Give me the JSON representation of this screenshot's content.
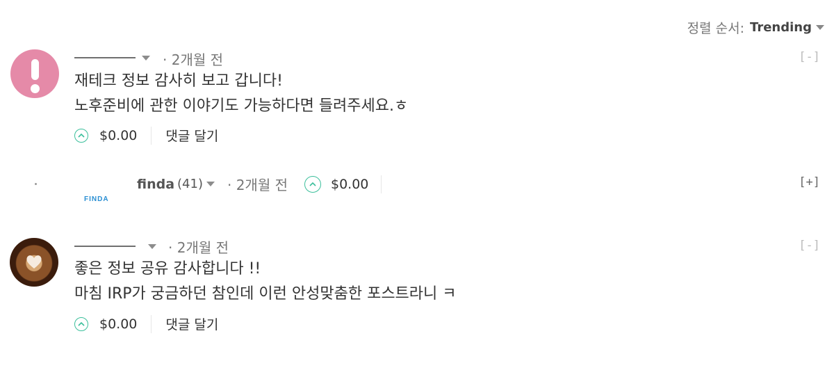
{
  "sort": {
    "label": "정렬 순서:",
    "value": "Trending"
  },
  "comments": [
    {
      "time": "2개월 전",
      "collapse": "[-]",
      "lines": [
        "재테크 정보 감사히 보고 갑니다!",
        "노후준비에 관한 이야기도 가능하다면 들려주세요.ㅎ"
      ],
      "payout": "$0.00",
      "reply": "댓글 달기",
      "avatar_color": "#e58aa8"
    },
    {
      "author": "finda",
      "reputation": "(41)",
      "time": "2개월 전",
      "payout": "$0.00",
      "collapse": "[+]",
      "logo_text": "FINDA",
      "logo_color": "#2a8fd3"
    },
    {
      "time": "2개월 전",
      "collapse": "[-]",
      "lines": [
        "좋은 정보 공유 감사합니다 !!",
        "마침 IRP가 궁금하던 참인데 이런 안성맞춤한 포스트라니 ㅋ"
      ],
      "payout": "$0.00",
      "reply": "댓글 달기"
    }
  ],
  "accent_color": "#3bbf9b"
}
